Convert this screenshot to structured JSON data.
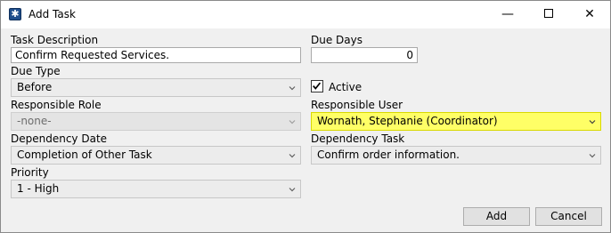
{
  "window": {
    "title": "Add Task",
    "minimize": "—",
    "close": "✕"
  },
  "fields": {
    "task_description": {
      "label": "Task Description",
      "value": "Confirm  Requested Services."
    },
    "due_days": {
      "label": "Due Days",
      "value": "0"
    },
    "due_type": {
      "label": "Due Type",
      "value": "Before"
    },
    "active": {
      "label": "Active",
      "checked": true
    },
    "responsible_role": {
      "label": "Responsible Role",
      "value": "-none-"
    },
    "responsible_user": {
      "label": "Responsible User",
      "value": "Wornath, Stephanie (Coordinator)"
    },
    "dependency_date": {
      "label": "Dependency Date",
      "value": "Completion of Other Task"
    },
    "dependency_task": {
      "label": "Dependency Task",
      "value": "Confirm order information."
    },
    "priority": {
      "label": "Priority",
      "value": "1 - High"
    }
  },
  "buttons": {
    "add": "Add",
    "cancel": "Cancel"
  },
  "colors": {
    "highlight": "#ffff66",
    "accent": "#1f4e8c"
  }
}
